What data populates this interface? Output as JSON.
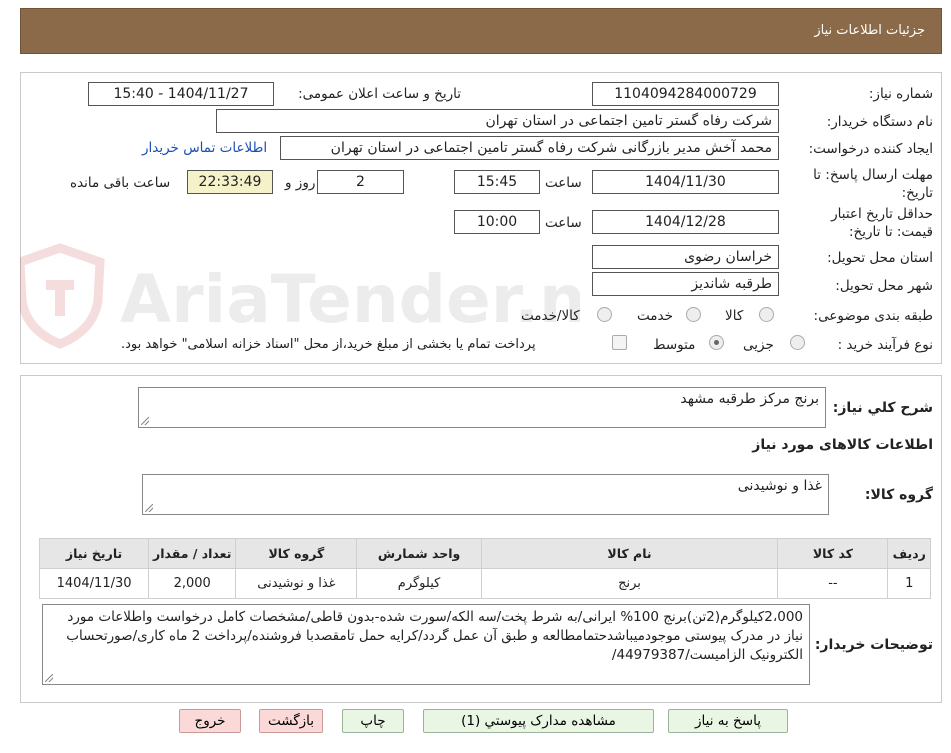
{
  "header": {
    "title": "جزئیات اطلاعات نیاز"
  },
  "form": {
    "need_number_label": "شماره نیاز:",
    "need_number": "1104094284000729",
    "announce_label": "تاریخ و ساعت اعلان عمومی:",
    "announce_value": "1404/11/27 - 15:40",
    "buyer_label": "نام دستگاه خریدار:",
    "buyer_value": "شرکت رفاه گستر تامین اجتماعی در استان تهران",
    "creator_label": "ایجاد کننده درخواست:",
    "creator_value": "محمد آخش مدیر بازرگانی شرکت رفاه گستر تامین اجتماعی در استان تهران",
    "contact_link": "اطلاعات تماس خریدار",
    "reply_deadline_label": "مهلت ارسال پاسخ: تا تاریخ:",
    "reply_date": "1404/11/30",
    "time_label": "ساعت",
    "reply_time": "15:45",
    "days_value": "2",
    "days_label": "روز و",
    "remaining_time": "22:33:49",
    "remaining_label": "ساعت باقی مانده",
    "validity_label": "حداقل تاریخ اعتبار قیمت: تا تاریخ:",
    "validity_date": "1404/12/28",
    "validity_time": "10:00",
    "province_label": "استان محل تحویل:",
    "province_value": "خراسان رضوی",
    "city_label": "شهر محل تحویل:",
    "city_value": "طرقبه شاندیز",
    "category_label": "طبقه بندی موضوعی:",
    "category_options": [
      "کالا",
      "خدمت",
      "کالا/خدمت"
    ],
    "process_label": "نوع فرآیند خرید :",
    "process_options": [
      "جزیی",
      "متوسط"
    ],
    "payment_note": "پرداخت تمام یا بخشی از مبلغ خرید،از محل \"اسناد خزانه اسلامی\" خواهد بود."
  },
  "watermark": {
    "text": "AriaTender.neT"
  },
  "summary": {
    "label": "شرح کلي نياز:",
    "value": "برنج مرکز طرقبه مشهد",
    "items_title": "اطلاعات کالاهای مورد نیاز",
    "group_label": "گروه کالا:",
    "group_value": "غذا و نوشیدنی"
  },
  "table": {
    "headers": [
      "ردیف",
      "کد کالا",
      "نام کالا",
      "واحد شمارش",
      "گروه کالا",
      "تعداد / مقدار",
      "تاریخ نیاز"
    ],
    "rows": [
      [
        "1",
        "--",
        "برنج",
        "کیلوگرم",
        "غذا و نوشیدنی",
        "2,000",
        "1404/11/30"
      ]
    ]
  },
  "notes": {
    "label": "توضیحات خریدار:",
    "text": "2،000کیلوگرم(2تن)برنج 100% ایرانی/به شرط پخت/سه الکه/سورت شده-بدون قاطی/مشخصات کامل درخواست واطلاعات مورد نیاز در مدرک پیوستی موجودمیباشدحتمامطالعه و طبق آن عمل گردد/کرایه حمل تامقصدبا فروشنده/پرداخت 2 ماه کاری/صورتحساب الکترونیک الزامیست/44979387/"
  },
  "buttons": {
    "reply": "پاسخ به نیاز",
    "attachments": "مشاهده مدارک پیوستي (1)",
    "print": "چاپ",
    "back": "بازگشت",
    "exit": "خروج"
  }
}
